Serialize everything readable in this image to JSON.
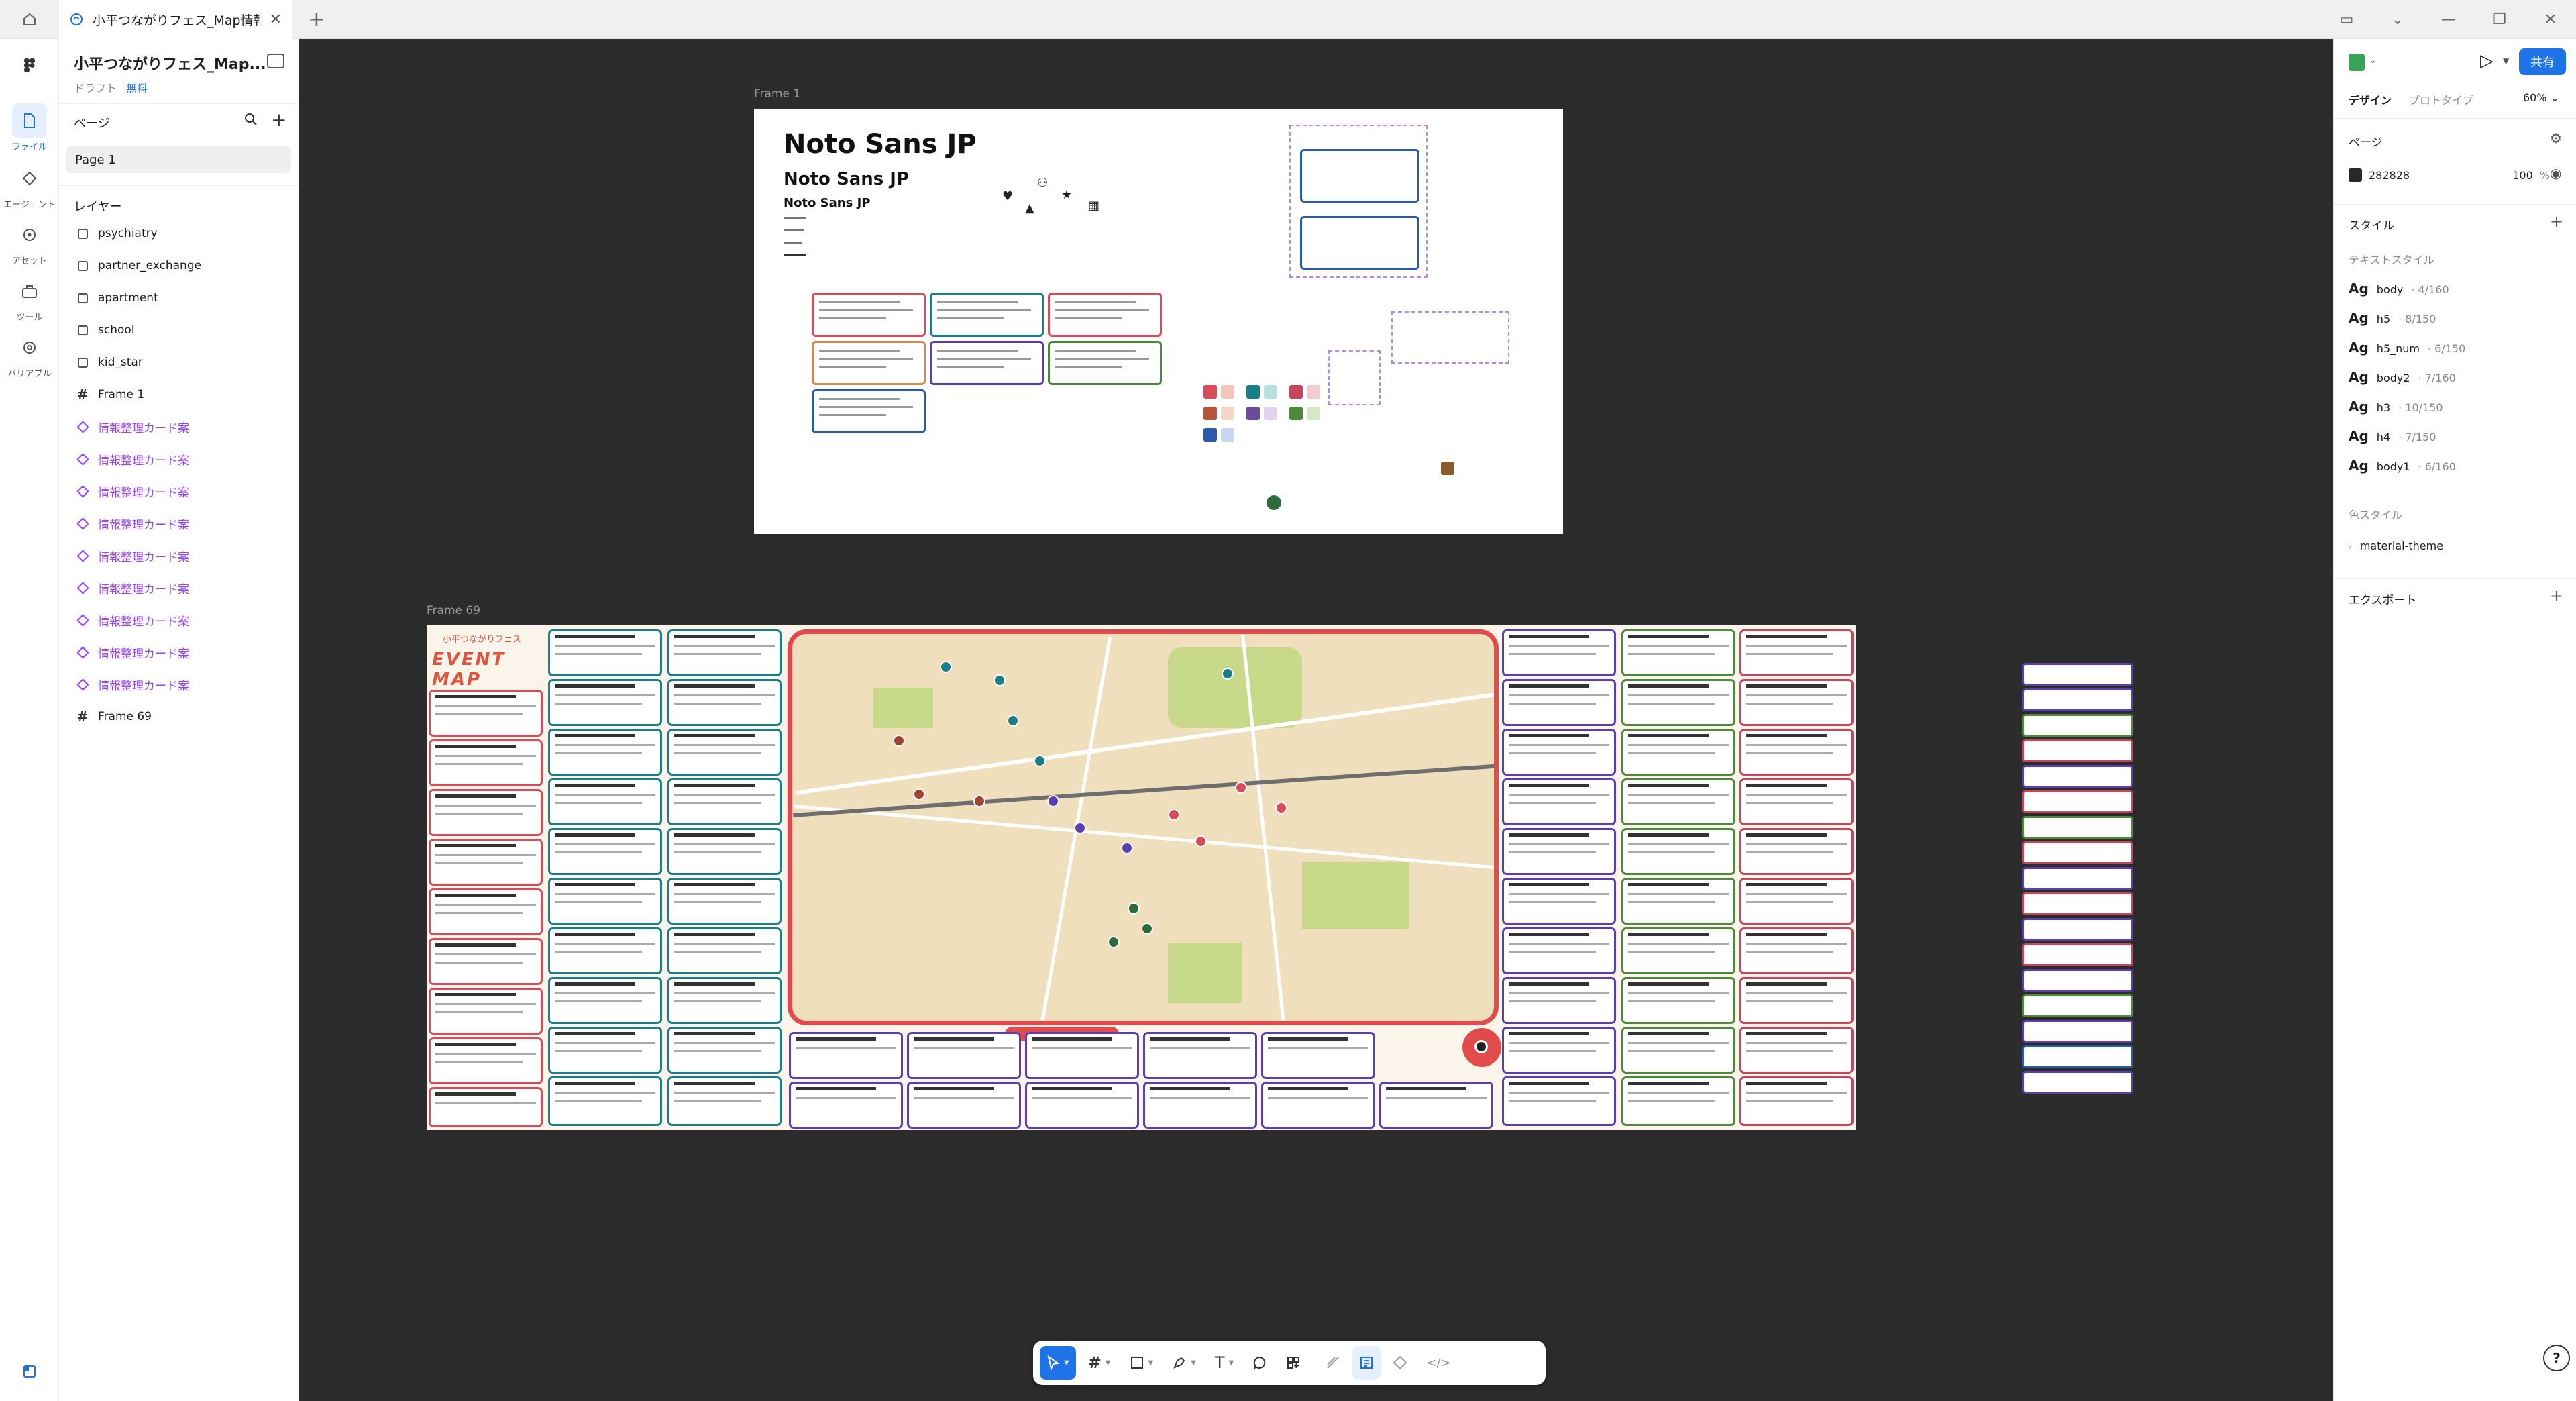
{
  "tabbar": {
    "file_tab_label": "小平つながりフェス_Map情報案"
  },
  "rail": {
    "items": [
      {
        "label": "ファイル"
      },
      {
        "label": "エージェント"
      },
      {
        "label": "アセット"
      },
      {
        "label": "ツール"
      },
      {
        "label": "バリアブル"
      }
    ]
  },
  "layers_panel": {
    "file_title": "小平つながりフェス_Map...",
    "draft_label": "ドラフト",
    "plan_label": "無料",
    "pages_heading": "ページ",
    "pages": [
      "Page 1"
    ],
    "layers_heading": "レイヤー",
    "layers": [
      {
        "name": "psychiatry",
        "kind": "rect"
      },
      {
        "name": "partner_exchange",
        "kind": "rect"
      },
      {
        "name": "apartment",
        "kind": "rect"
      },
      {
        "name": "school",
        "kind": "rect"
      },
      {
        "name": "kid_star",
        "kind": "rect"
      },
      {
        "name": "Frame 1",
        "kind": "frame"
      },
      {
        "name": "情報整理カード案",
        "kind": "component"
      },
      {
        "name": "情報整理カード案",
        "kind": "component"
      },
      {
        "name": "情報整理カード案",
        "kind": "component"
      },
      {
        "name": "情報整理カード案",
        "kind": "component"
      },
      {
        "name": "情報整理カード案",
        "kind": "component"
      },
      {
        "name": "情報整理カード案",
        "kind": "component"
      },
      {
        "name": "情報整理カード案",
        "kind": "component"
      },
      {
        "name": "情報整理カード案",
        "kind": "component"
      },
      {
        "name": "情報整理カード案",
        "kind": "component"
      },
      {
        "name": "Frame 69",
        "kind": "frame"
      }
    ]
  },
  "canvas": {
    "frame1_label": "Frame 1",
    "frame69_label": "Frame 69",
    "frame1": {
      "heading_h1": "Noto Sans JP",
      "heading_h2": "Noto Sans JP",
      "heading_h3": "Noto Sans JP"
    },
    "frame69": {
      "title_sub": "小平つながりフェス",
      "title_main": "EVENT MAP"
    }
  },
  "design_panel": {
    "share_label": "共有",
    "tabs": [
      "デザイン",
      "プロトタイプ"
    ],
    "zoom": "60%",
    "page_section": "ページ",
    "page_color_hex": "282828",
    "page_color_opacity": "100",
    "page_color_unit": "%",
    "style_section": "スタイル",
    "text_styles_heading": "テキストスタイル",
    "text_styles": [
      {
        "name": "body",
        "meta": "· 4/160"
      },
      {
        "name": "h5",
        "meta": "· 8/150"
      },
      {
        "name": "h5_num",
        "meta": "· 6/150"
      },
      {
        "name": "body2",
        "meta": "· 7/160"
      },
      {
        "name": "h3",
        "meta": "· 10/150"
      },
      {
        "name": "h4",
        "meta": "· 7/150"
      },
      {
        "name": "body1",
        "meta": "· 6/160"
      }
    ],
    "color_styles_heading": "色スタイル",
    "color_styles": [
      "material-theme"
    ],
    "export_section": "エクスポート",
    "help": "?"
  },
  "colors": {
    "accent": "#1e73e8",
    "canvas_bg": "#2c2c2c",
    "component": "#9747ff",
    "map_border": "#e24b4b"
  }
}
